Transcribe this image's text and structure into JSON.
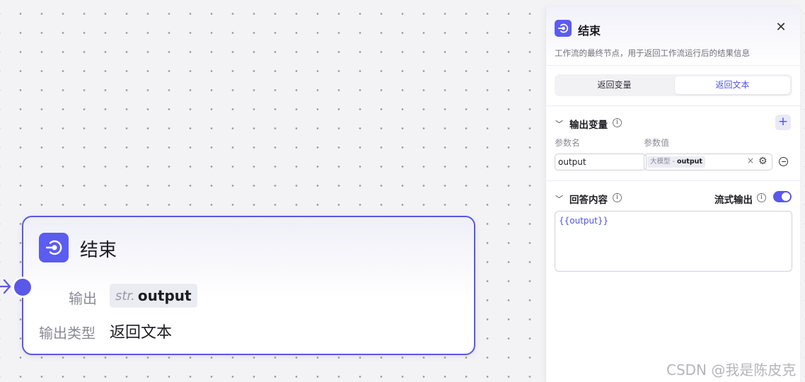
{
  "node": {
    "title": "结束",
    "icon": "end-icon",
    "output_label": "输出",
    "output_type_prefix": "str.",
    "output_value": "output",
    "output_type_label": "输出类型",
    "output_type_value": "返回文本"
  },
  "panel": {
    "title": "结束",
    "icon": "end-icon",
    "close_icon": "close-icon",
    "description": "工作流的最终节点，用于返回工作流运行后的结果信息",
    "tabs": [
      {
        "label": "返回变量",
        "selected": false
      },
      {
        "label": "返回文本",
        "selected": true
      }
    ],
    "output_vars": {
      "title": "输出变量",
      "add_label": "+",
      "param_name_label": "参数名",
      "param_value_label": "参数值",
      "rows": [
        {
          "name": "output",
          "source": "大模型",
          "separator": " - ",
          "value": "output",
          "clear": "×"
        }
      ]
    },
    "answer": {
      "title": "回答内容",
      "stream_label": "流式输出",
      "stream_on": true,
      "content": "{{output}}"
    }
  },
  "watermark": "CSDN @我是陈皮克",
  "colors": {
    "accent": "#5b57e8",
    "link": "#4d53e8"
  }
}
